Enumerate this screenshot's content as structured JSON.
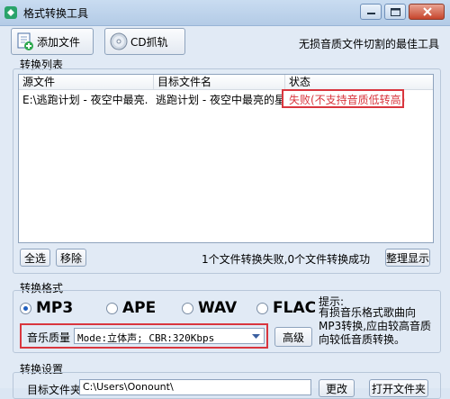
{
  "window": {
    "title": "格式转换工具"
  },
  "toolbar": {
    "add_files_label": "添加文件",
    "cd_rip_label": "CD抓轨",
    "tagline": "无损音质文件切割的最佳工具"
  },
  "convert_list": {
    "group_label": "转换列表",
    "columns": [
      "源文件",
      "目标文件名",
      "状态"
    ],
    "rows": [
      {
        "source": "E:\\逃跑计划 - 夜空中最亮.",
        "target": "逃跑计划 - 夜空中最亮的星.",
        "status": "失败(不支持音质低转高)"
      }
    ],
    "select_all_label": "全选",
    "remove_label": "移除",
    "summary": "1个文件转换失败,0个文件转换成功",
    "tidy_label": "整理显示"
  },
  "format": {
    "group_label": "转换格式",
    "options": [
      "MP3",
      "APE",
      "WAV",
      "FLAC"
    ],
    "selected": "MP3",
    "hint_title": "提示:",
    "hint_text": "有损音乐格式歌曲向MP3转换,应由较高音质向较低音质转换。",
    "quality_label": "音乐质量",
    "quality_value": "Mode:立体声; CBR:320Kbps",
    "advanced_label": "高级"
  },
  "settings": {
    "group_label": "转换设置",
    "output_label": "目标文件夹",
    "output_value": "C:\\Users\\Oonount\\",
    "change_label": "更改",
    "open_label": "打开文件夹"
  },
  "colors": {
    "accent_red": "#d9363e",
    "window_bg": "#e1eaf5"
  }
}
